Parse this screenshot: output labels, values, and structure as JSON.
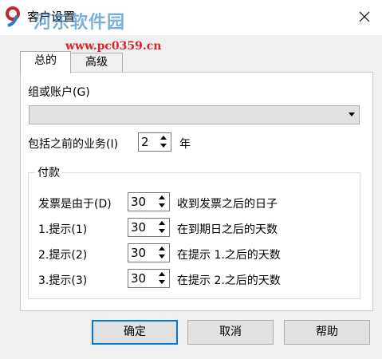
{
  "window": {
    "title": "客户设置",
    "watermark_site": "河东软件园",
    "watermark_url": "www.pc0359.cn"
  },
  "tabs": [
    {
      "label": "总的",
      "selected": true
    },
    {
      "label": "高级",
      "selected": false
    }
  ],
  "general": {
    "group_account_label": "组或账户(G)",
    "group_account_value": "",
    "include_prior_label": "包括之前的业务(I)",
    "include_prior_value": "2",
    "include_prior_unit": "年",
    "payment": {
      "title": "付款",
      "rows": [
        {
          "label": "发票是由于(D)",
          "value": "30",
          "suffix": "收到发票之后的日子"
        },
        {
          "label": "1.提示(1)",
          "value": "30",
          "suffix": "在到期日之后的天数"
        },
        {
          "label": "2.提示(2)",
          "value": "30",
          "suffix": "在提示 1.之后的天数"
        },
        {
          "label": "3.提示(3)",
          "value": "30",
          "suffix": "在提示 2.之后的天数"
        }
      ]
    }
  },
  "buttons": {
    "ok": "确定",
    "cancel": "取消",
    "help": "帮助"
  },
  "colors": {
    "accent": "#0078d7",
    "watermark_blue": "#2a7fc4",
    "watermark_red": "#d9252a"
  }
}
